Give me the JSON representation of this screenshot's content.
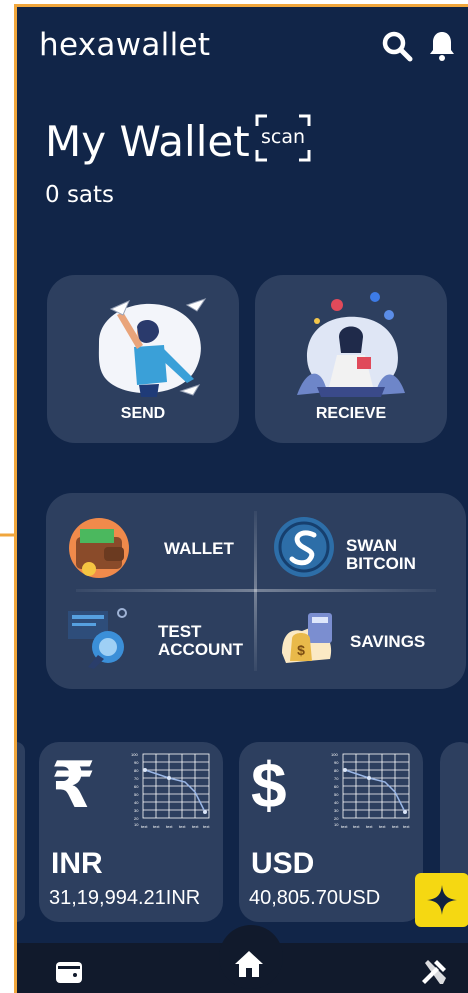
{
  "header": {
    "title": "hexawallet"
  },
  "icons": {
    "search": "search-icon",
    "bell": "bell-icon",
    "scan": "scan-frame-icon",
    "wallet_nav": "wallet-icon",
    "home_nav": "home-icon",
    "tools_nav": "tools-icon",
    "sparkle": "sparkle-icon"
  },
  "wallet": {
    "title": "My Wallet",
    "scan_label": "scan",
    "balance": "0 sats"
  },
  "actions": [
    {
      "label": "SEND"
    },
    {
      "label": "RECIEVE"
    }
  ],
  "services": {
    "wallet": {
      "label": "WALLET"
    },
    "swan": {
      "line1": "SWAN",
      "line2": "BITCOIN"
    },
    "test": {
      "line1": "TEST",
      "line2": "ACCOUNT"
    },
    "savings": {
      "label": "SAVINGS"
    }
  },
  "mini_chart": {
    "y_ticks": [
      "100",
      "90",
      "80",
      "70",
      "60",
      "50",
      "40",
      "30",
      "20",
      "10"
    ],
    "x_ticks": [
      "text",
      "text",
      "text",
      "text",
      "text",
      "text"
    ]
  },
  "currencies": [
    {
      "symbol": "₹",
      "code": "INR",
      "amount": "31,19,994.21INR"
    },
    {
      "symbol": "$",
      "code": "USD",
      "amount": "40,805.70USD"
    }
  ],
  "colors": {
    "background": "#112548",
    "card": "#2d3f5f",
    "accent_border": "#f0a63c",
    "fab": "#f5d812",
    "nav": "#111a2c"
  }
}
